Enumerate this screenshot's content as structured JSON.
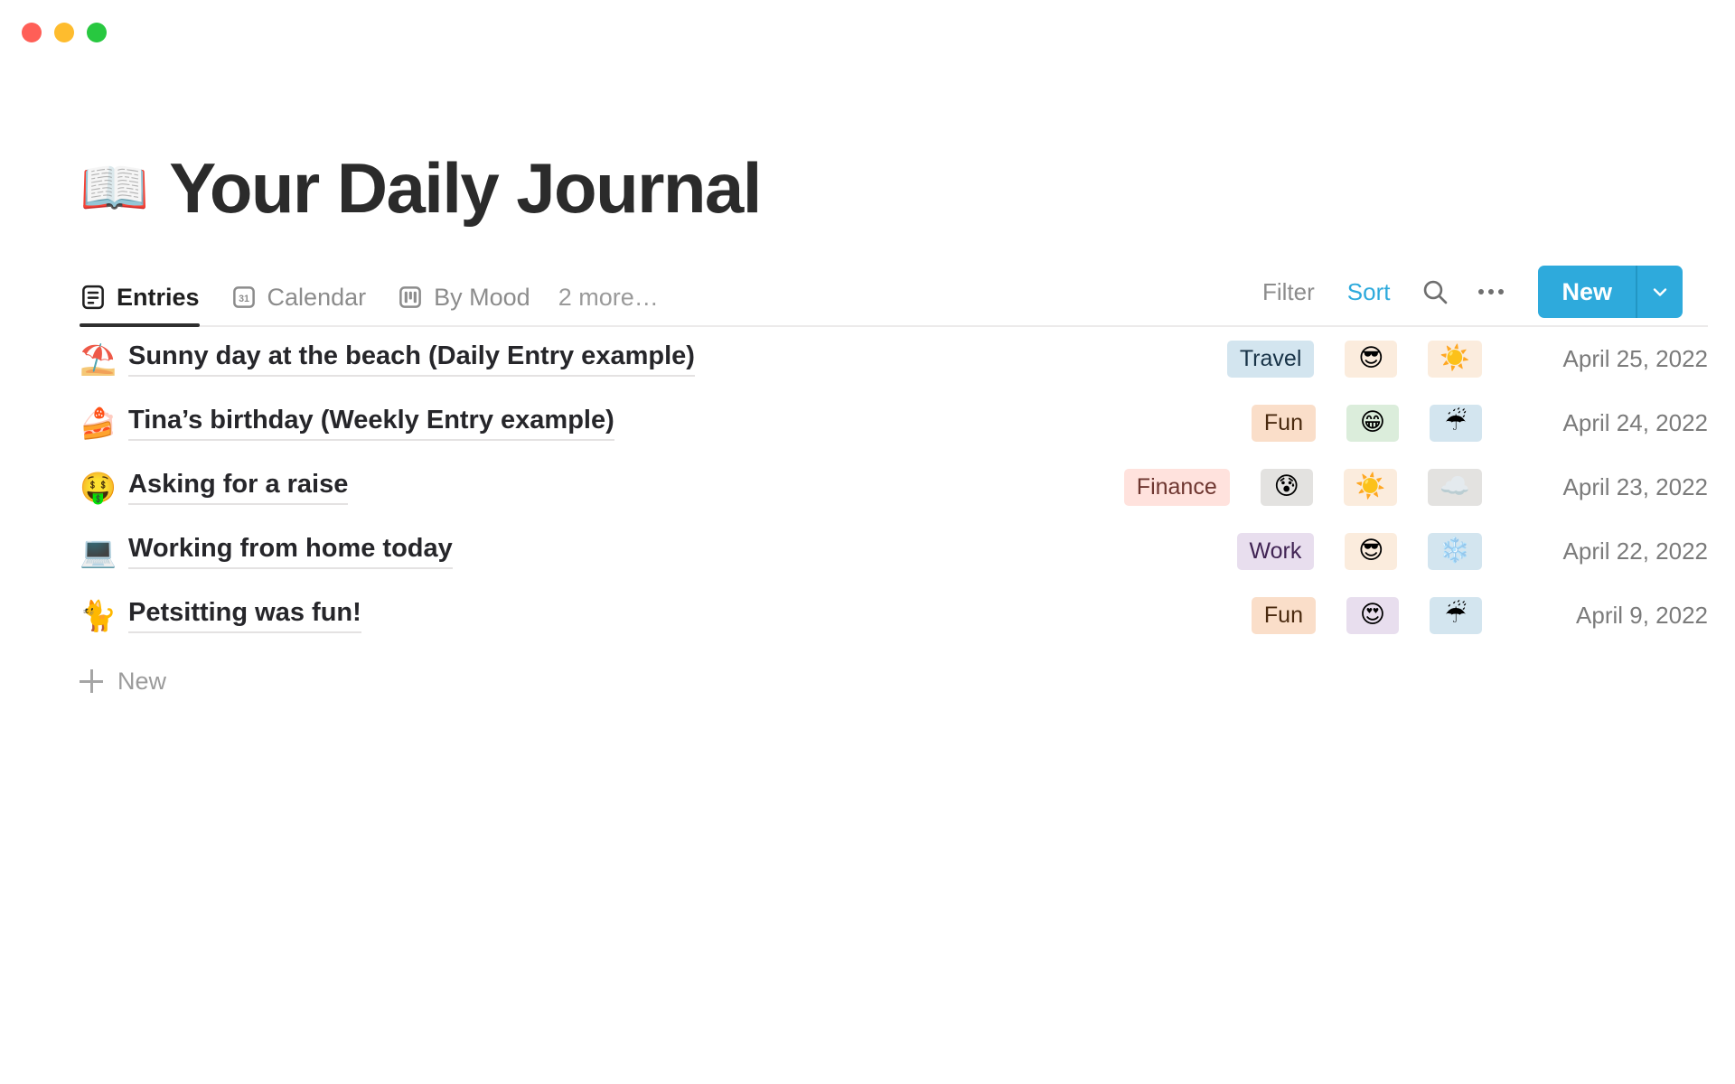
{
  "window": {
    "traffic_lights": [
      {
        "name": "close",
        "color": "#ff5f57"
      },
      {
        "name": "minimize",
        "color": "#febc2e"
      },
      {
        "name": "zoom",
        "color": "#28c840"
      }
    ]
  },
  "header": {
    "emoji": "📖",
    "title": "Your Daily Journal"
  },
  "view_bar": {
    "tabs": [
      {
        "label": "Entries",
        "icon": "list-view-icon",
        "active": true
      },
      {
        "label": "Calendar",
        "icon": "calendar-view-icon",
        "active": false
      },
      {
        "label": "By Mood",
        "icon": "board-view-icon",
        "active": false
      }
    ],
    "more_label": "2 more…",
    "filter_label": "Filter",
    "sort_label": "Sort",
    "search_icon": "search-icon",
    "overflow_icon": "more-options-icon",
    "new_label": "New",
    "new_caret_icon": "chevron-down-icon",
    "accent_color": "#2eaadc"
  },
  "entries": [
    {
      "emoji": "⛱️",
      "title": "Sunny day at the beach (Daily Entry example)",
      "tag": {
        "label": "Travel",
        "bg": "#d3e5ef",
        "fg": "#183347"
      },
      "mood": {
        "emoji": "😎",
        "bg": "#fbecdd"
      },
      "weather": {
        "emoji": "☀️",
        "bg": "#fbecdd"
      },
      "date": "April 25, 2022"
    },
    {
      "emoji": "🍰",
      "title": "Tina’s birthday (Weekly Entry example)",
      "tag": {
        "label": "Fun",
        "bg": "#fadec9",
        "fg": "#49290e"
      },
      "mood": {
        "emoji": "😁",
        "bg": "#dbeddb"
      },
      "weather": {
        "emoji": "☔",
        "bg": "#d3e5ef"
      },
      "date": "April 24, 2022"
    },
    {
      "emoji": "🤑",
      "title": "Asking for a raise",
      "tag": {
        "label": "Finance",
        "bg": "#ffe2dd",
        "fg": "#6e3630"
      },
      "mood": {
        "emoji": "😰",
        "bg": "#e3e2e0"
      },
      "weather": {
        "emoji": "☀️",
        "bg": "#fbecdd"
      },
      "extra": {
        "emoji": "☁️",
        "bg": "#e3e2e0"
      },
      "date": "April 23, 2022"
    },
    {
      "emoji": "💻",
      "title": "Working from home today",
      "tag": {
        "label": "Work",
        "bg": "#e8deee",
        "fg": "#412454"
      },
      "mood": {
        "emoji": "😎",
        "bg": "#fbecdd"
      },
      "weather": {
        "emoji": "❄️",
        "bg": "#d3e5ef"
      },
      "date": "April 22, 2022"
    },
    {
      "emoji": "🐈",
      "title": "Petsitting was fun!",
      "tag": {
        "label": "Fun",
        "bg": "#fadec9",
        "fg": "#49290e"
      },
      "mood": {
        "emoji": "😍",
        "bg": "#e8deee"
      },
      "weather": {
        "emoji": "☔",
        "bg": "#d3e5ef"
      },
      "date": "April 9, 2022"
    }
  ],
  "footer": {
    "new_row_label": "New",
    "plus_icon": "plus-icon"
  }
}
